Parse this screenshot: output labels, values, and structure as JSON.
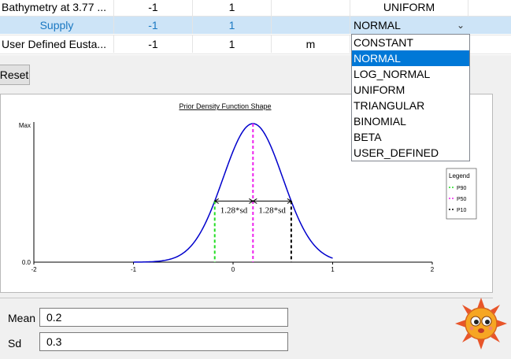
{
  "table": {
    "rows": [
      {
        "name": "Bathymetry at 3.77 ...",
        "col1": "-1",
        "col2": "1",
        "col3": "",
        "col4": "UNIFORM"
      },
      {
        "name": "Supply",
        "col1": "-1",
        "col2": "1",
        "col3": "",
        "col4": "NORMAL"
      },
      {
        "name": "User Defined Eusta...",
        "col1": "-1",
        "col2": "1",
        "col3": "m",
        "col4": ""
      }
    ],
    "combo_arrow": "⌄"
  },
  "dropdown": {
    "options": [
      "CONSTANT",
      "NORMAL",
      "LOG_NORMAL",
      "UNIFORM",
      "TRIANGULAR",
      "BINOMIAL",
      "BETA",
      "USER_DEFINED"
    ],
    "selected": "NORMAL"
  },
  "reset_label": "Reset",
  "chart_data": {
    "type": "line",
    "title": "Prior Density Function Shape",
    "xlim": [
      -2,
      2
    ],
    "x_ticks": [
      "-2",
      "-1",
      "0",
      "1",
      "2"
    ],
    "y_tick_labels": [
      "Max",
      "0.0"
    ],
    "mean": 0.2,
    "sd": 0.3,
    "curve_range": [
      -1,
      1
    ],
    "markers": [
      {
        "name": "P90",
        "x": -0.184,
        "color": "#22dd22"
      },
      {
        "name": "P50",
        "x": 0.2,
        "color": "#ee22ee"
      },
      {
        "name": "P10",
        "x": 0.584,
        "color": "#000000"
      }
    ],
    "annotations": [
      "1.28*sd",
      "1.28*sd"
    ],
    "legend": {
      "title": "Legend",
      "placement": "right"
    },
    "colors": {
      "curve": "#0000cc"
    }
  },
  "form": {
    "mean_label": "Mean",
    "mean_value": "0.2",
    "sd_label": "Sd",
    "sd_value": "0.3"
  }
}
